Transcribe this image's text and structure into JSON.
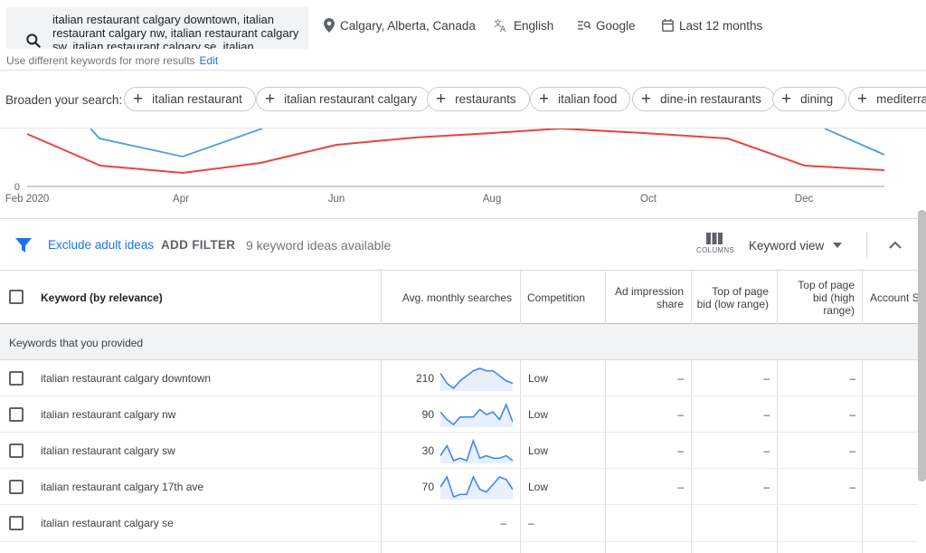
{
  "search": {
    "query": "italian restaurant calgary downtown, italian restaurant calgary nw, italian restaurant calgary sw, italian restaurant calgary se, italian",
    "hint": "Use different keywords for more results",
    "edit_label": "Edit"
  },
  "filters_top": {
    "location": "Calgary, Alberta, Canada",
    "language": "English",
    "network": "Google",
    "date_range": "Last 12 months"
  },
  "broaden": {
    "label": "Broaden your search:",
    "chips": [
      "italian restaurant",
      "italian restaurant calgary",
      "restaurants",
      "italian food",
      "dine-in restaurants",
      "dining",
      "mediterra"
    ]
  },
  "chart_data": {
    "type": "line",
    "x_labels": [
      "Feb 2020",
      "Apr",
      "Jun",
      "Aug",
      "Oct",
      "Dec"
    ],
    "y_tick": "0",
    "series": [
      {
        "color": "#4285f4",
        "visible_partial": true
      },
      {
        "color": "#ea4335"
      }
    ]
  },
  "filterbar": {
    "exclude_adult": "Exclude adult ideas",
    "add_filter": "ADD FILTER",
    "available": "9 keyword ideas available",
    "columns_label": "COLUMNS",
    "keyword_view": "Keyword view"
  },
  "table": {
    "headers": {
      "keyword": "Keyword (by relevance)",
      "avg_searches": "Avg. monthly searches",
      "competition": "Competition",
      "ad_impression": "Ad impression share",
      "bid_low": "Top of page bid (low range)",
      "bid_high": "Top of page bid (high range)",
      "account": "Account S"
    },
    "group_label": "Keywords that you provided",
    "rows": [
      {
        "keyword": "italian restaurant calgary downtown",
        "searches": "210",
        "competition": "Low",
        "ad_impression": "–",
        "bid_low": "–",
        "bid_high": "–",
        "trend": [
          6,
          2,
          0,
          3,
          5,
          7,
          8,
          7,
          7,
          5,
          3,
          2
        ]
      },
      {
        "keyword": "italian restaurant calgary nw",
        "searches": "90",
        "competition": "Low",
        "ad_impression": "–",
        "bid_low": "–",
        "bid_high": "–",
        "trend": [
          5,
          2,
          0,
          3,
          3,
          3,
          6,
          4,
          5,
          2,
          8,
          1
        ]
      },
      {
        "keyword": "italian restaurant calgary sw",
        "searches": "30",
        "competition": "Low",
        "ad_impression": "–",
        "bid_low": "–",
        "bid_high": "–",
        "trend": [
          3,
          7,
          1,
          2,
          1,
          9,
          2,
          3,
          2,
          2,
          3,
          1
        ]
      },
      {
        "keyword": "italian restaurant calgary 17th ave",
        "searches": "70",
        "competition": "Low",
        "ad_impression": "–",
        "bid_low": "–",
        "bid_high": "–",
        "trend": [
          4,
          8,
          0,
          1,
          1,
          8,
          3,
          2,
          5,
          8,
          7,
          3
        ]
      },
      {
        "keyword": "italian restaurant calgary se",
        "searches": "–",
        "competition": "–",
        "ad_impression": "",
        "bid_low": "",
        "bid_high": "",
        "trend": []
      }
    ]
  }
}
